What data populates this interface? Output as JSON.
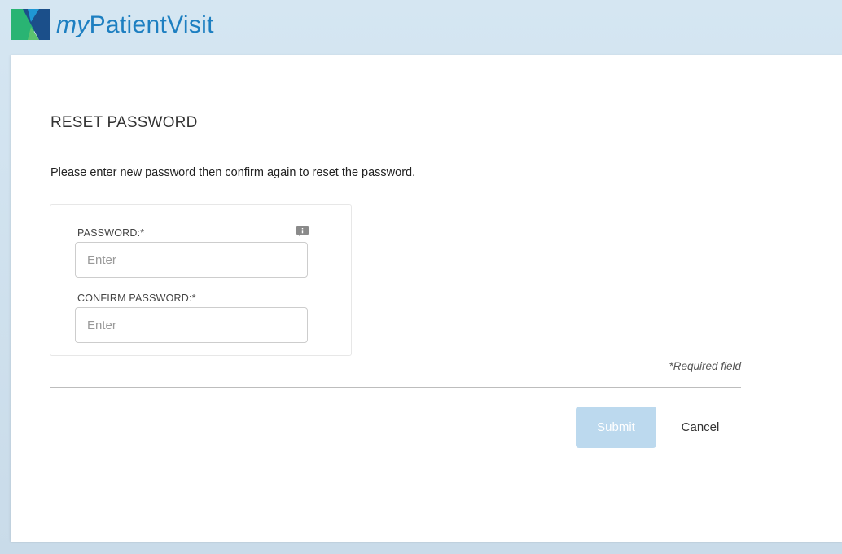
{
  "header": {
    "brand_prefix": "my",
    "brand_name": "PatientVisit",
    "logo_icon": "mypatientvisit-logo-icon",
    "brand_color": "#1d7fc1"
  },
  "page": {
    "title": "RESET PASSWORD",
    "instructions": "Please enter new password then confirm again to reset the password."
  },
  "form": {
    "password": {
      "label": "PASSWORD:*",
      "placeholder": "Enter",
      "value": "",
      "info_icon": "info-icon"
    },
    "confirm_password": {
      "label": "CONFIRM PASSWORD:*",
      "placeholder": "Enter",
      "value": ""
    },
    "required_note": "*Required field"
  },
  "actions": {
    "submit_label": "Submit",
    "submit_color": "#bcd9ee",
    "cancel_label": "Cancel"
  }
}
